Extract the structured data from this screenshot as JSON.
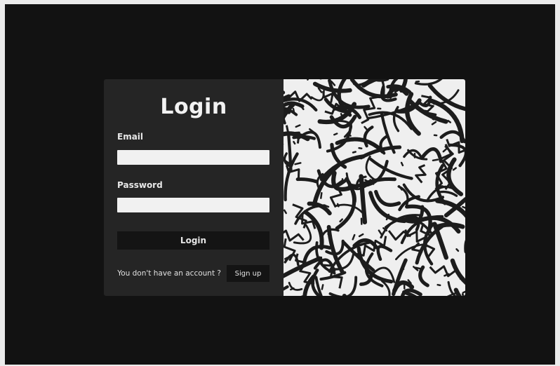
{
  "login_form": {
    "title": "Login",
    "email_label": "Email",
    "email_value": "",
    "password_label": "Password",
    "password_value": "",
    "login_button": "Login",
    "no_account_text": "You don't have an account ?",
    "signup_button": "Sign up"
  },
  "colors": {
    "page_background": "#121212",
    "form_panel": "#252525",
    "button": "#141414",
    "input": "#f1f1f1",
    "art_background": "#efefef",
    "art_strokes": "#1c1c1c"
  },
  "decoration": {
    "art_panel": "abstract-black-white-squiggle-pattern"
  }
}
